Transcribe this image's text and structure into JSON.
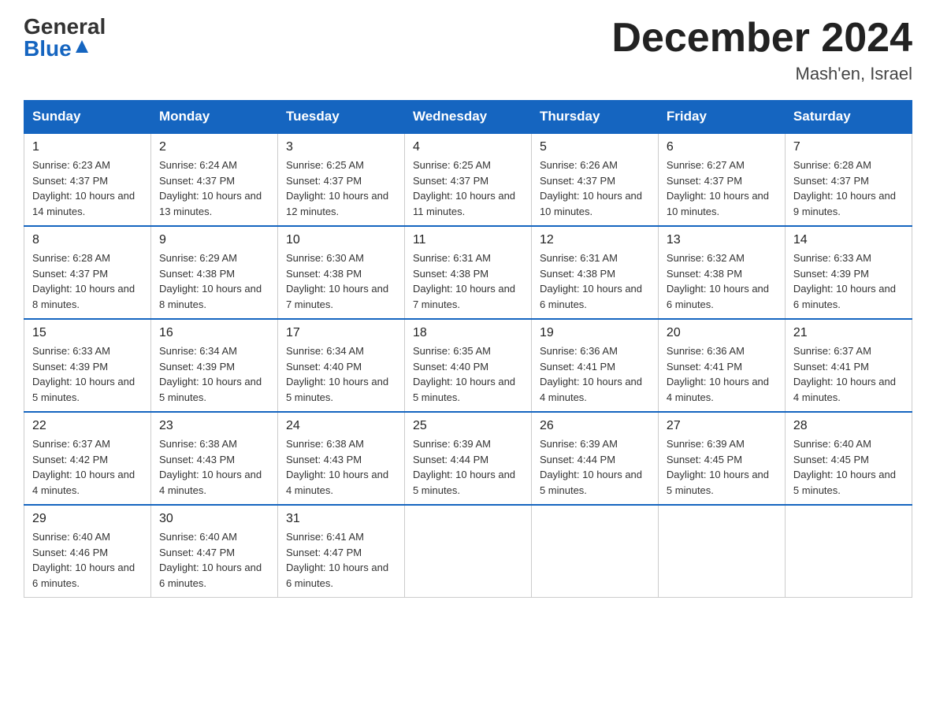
{
  "header": {
    "logo_general": "General",
    "logo_blue": "Blue",
    "month_title": "December 2024",
    "location": "Mash'en, Israel"
  },
  "weekdays": [
    "Sunday",
    "Monday",
    "Tuesday",
    "Wednesday",
    "Thursday",
    "Friday",
    "Saturday"
  ],
  "weeks": [
    [
      {
        "day": "1",
        "sunrise": "6:23 AM",
        "sunset": "4:37 PM",
        "daylight": "10 hours and 14 minutes."
      },
      {
        "day": "2",
        "sunrise": "6:24 AM",
        "sunset": "4:37 PM",
        "daylight": "10 hours and 13 minutes."
      },
      {
        "day": "3",
        "sunrise": "6:25 AM",
        "sunset": "4:37 PM",
        "daylight": "10 hours and 12 minutes."
      },
      {
        "day": "4",
        "sunrise": "6:25 AM",
        "sunset": "4:37 PM",
        "daylight": "10 hours and 11 minutes."
      },
      {
        "day": "5",
        "sunrise": "6:26 AM",
        "sunset": "4:37 PM",
        "daylight": "10 hours and 10 minutes."
      },
      {
        "day": "6",
        "sunrise": "6:27 AM",
        "sunset": "4:37 PM",
        "daylight": "10 hours and 10 minutes."
      },
      {
        "day": "7",
        "sunrise": "6:28 AM",
        "sunset": "4:37 PM",
        "daylight": "10 hours and 9 minutes."
      }
    ],
    [
      {
        "day": "8",
        "sunrise": "6:28 AM",
        "sunset": "4:37 PM",
        "daylight": "10 hours and 8 minutes."
      },
      {
        "day": "9",
        "sunrise": "6:29 AM",
        "sunset": "4:38 PM",
        "daylight": "10 hours and 8 minutes."
      },
      {
        "day": "10",
        "sunrise": "6:30 AM",
        "sunset": "4:38 PM",
        "daylight": "10 hours and 7 minutes."
      },
      {
        "day": "11",
        "sunrise": "6:31 AM",
        "sunset": "4:38 PM",
        "daylight": "10 hours and 7 minutes."
      },
      {
        "day": "12",
        "sunrise": "6:31 AM",
        "sunset": "4:38 PM",
        "daylight": "10 hours and 6 minutes."
      },
      {
        "day": "13",
        "sunrise": "6:32 AM",
        "sunset": "4:38 PM",
        "daylight": "10 hours and 6 minutes."
      },
      {
        "day": "14",
        "sunrise": "6:33 AM",
        "sunset": "4:39 PM",
        "daylight": "10 hours and 6 minutes."
      }
    ],
    [
      {
        "day": "15",
        "sunrise": "6:33 AM",
        "sunset": "4:39 PM",
        "daylight": "10 hours and 5 minutes."
      },
      {
        "day": "16",
        "sunrise": "6:34 AM",
        "sunset": "4:39 PM",
        "daylight": "10 hours and 5 minutes."
      },
      {
        "day": "17",
        "sunrise": "6:34 AM",
        "sunset": "4:40 PM",
        "daylight": "10 hours and 5 minutes."
      },
      {
        "day": "18",
        "sunrise": "6:35 AM",
        "sunset": "4:40 PM",
        "daylight": "10 hours and 5 minutes."
      },
      {
        "day": "19",
        "sunrise": "6:36 AM",
        "sunset": "4:41 PM",
        "daylight": "10 hours and 4 minutes."
      },
      {
        "day": "20",
        "sunrise": "6:36 AM",
        "sunset": "4:41 PM",
        "daylight": "10 hours and 4 minutes."
      },
      {
        "day": "21",
        "sunrise": "6:37 AM",
        "sunset": "4:41 PM",
        "daylight": "10 hours and 4 minutes."
      }
    ],
    [
      {
        "day": "22",
        "sunrise": "6:37 AM",
        "sunset": "4:42 PM",
        "daylight": "10 hours and 4 minutes."
      },
      {
        "day": "23",
        "sunrise": "6:38 AM",
        "sunset": "4:43 PM",
        "daylight": "10 hours and 4 minutes."
      },
      {
        "day": "24",
        "sunrise": "6:38 AM",
        "sunset": "4:43 PM",
        "daylight": "10 hours and 4 minutes."
      },
      {
        "day": "25",
        "sunrise": "6:39 AM",
        "sunset": "4:44 PM",
        "daylight": "10 hours and 5 minutes."
      },
      {
        "day": "26",
        "sunrise": "6:39 AM",
        "sunset": "4:44 PM",
        "daylight": "10 hours and 5 minutes."
      },
      {
        "day": "27",
        "sunrise": "6:39 AM",
        "sunset": "4:45 PM",
        "daylight": "10 hours and 5 minutes."
      },
      {
        "day": "28",
        "sunrise": "6:40 AM",
        "sunset": "4:45 PM",
        "daylight": "10 hours and 5 minutes."
      }
    ],
    [
      {
        "day": "29",
        "sunrise": "6:40 AM",
        "sunset": "4:46 PM",
        "daylight": "10 hours and 6 minutes."
      },
      {
        "day": "30",
        "sunrise": "6:40 AM",
        "sunset": "4:47 PM",
        "daylight": "10 hours and 6 minutes."
      },
      {
        "day": "31",
        "sunrise": "6:41 AM",
        "sunset": "4:47 PM",
        "daylight": "10 hours and 6 minutes."
      },
      null,
      null,
      null,
      null
    ]
  ],
  "labels": {
    "sunrise": "Sunrise:",
    "sunset": "Sunset:",
    "daylight": "Daylight:"
  }
}
